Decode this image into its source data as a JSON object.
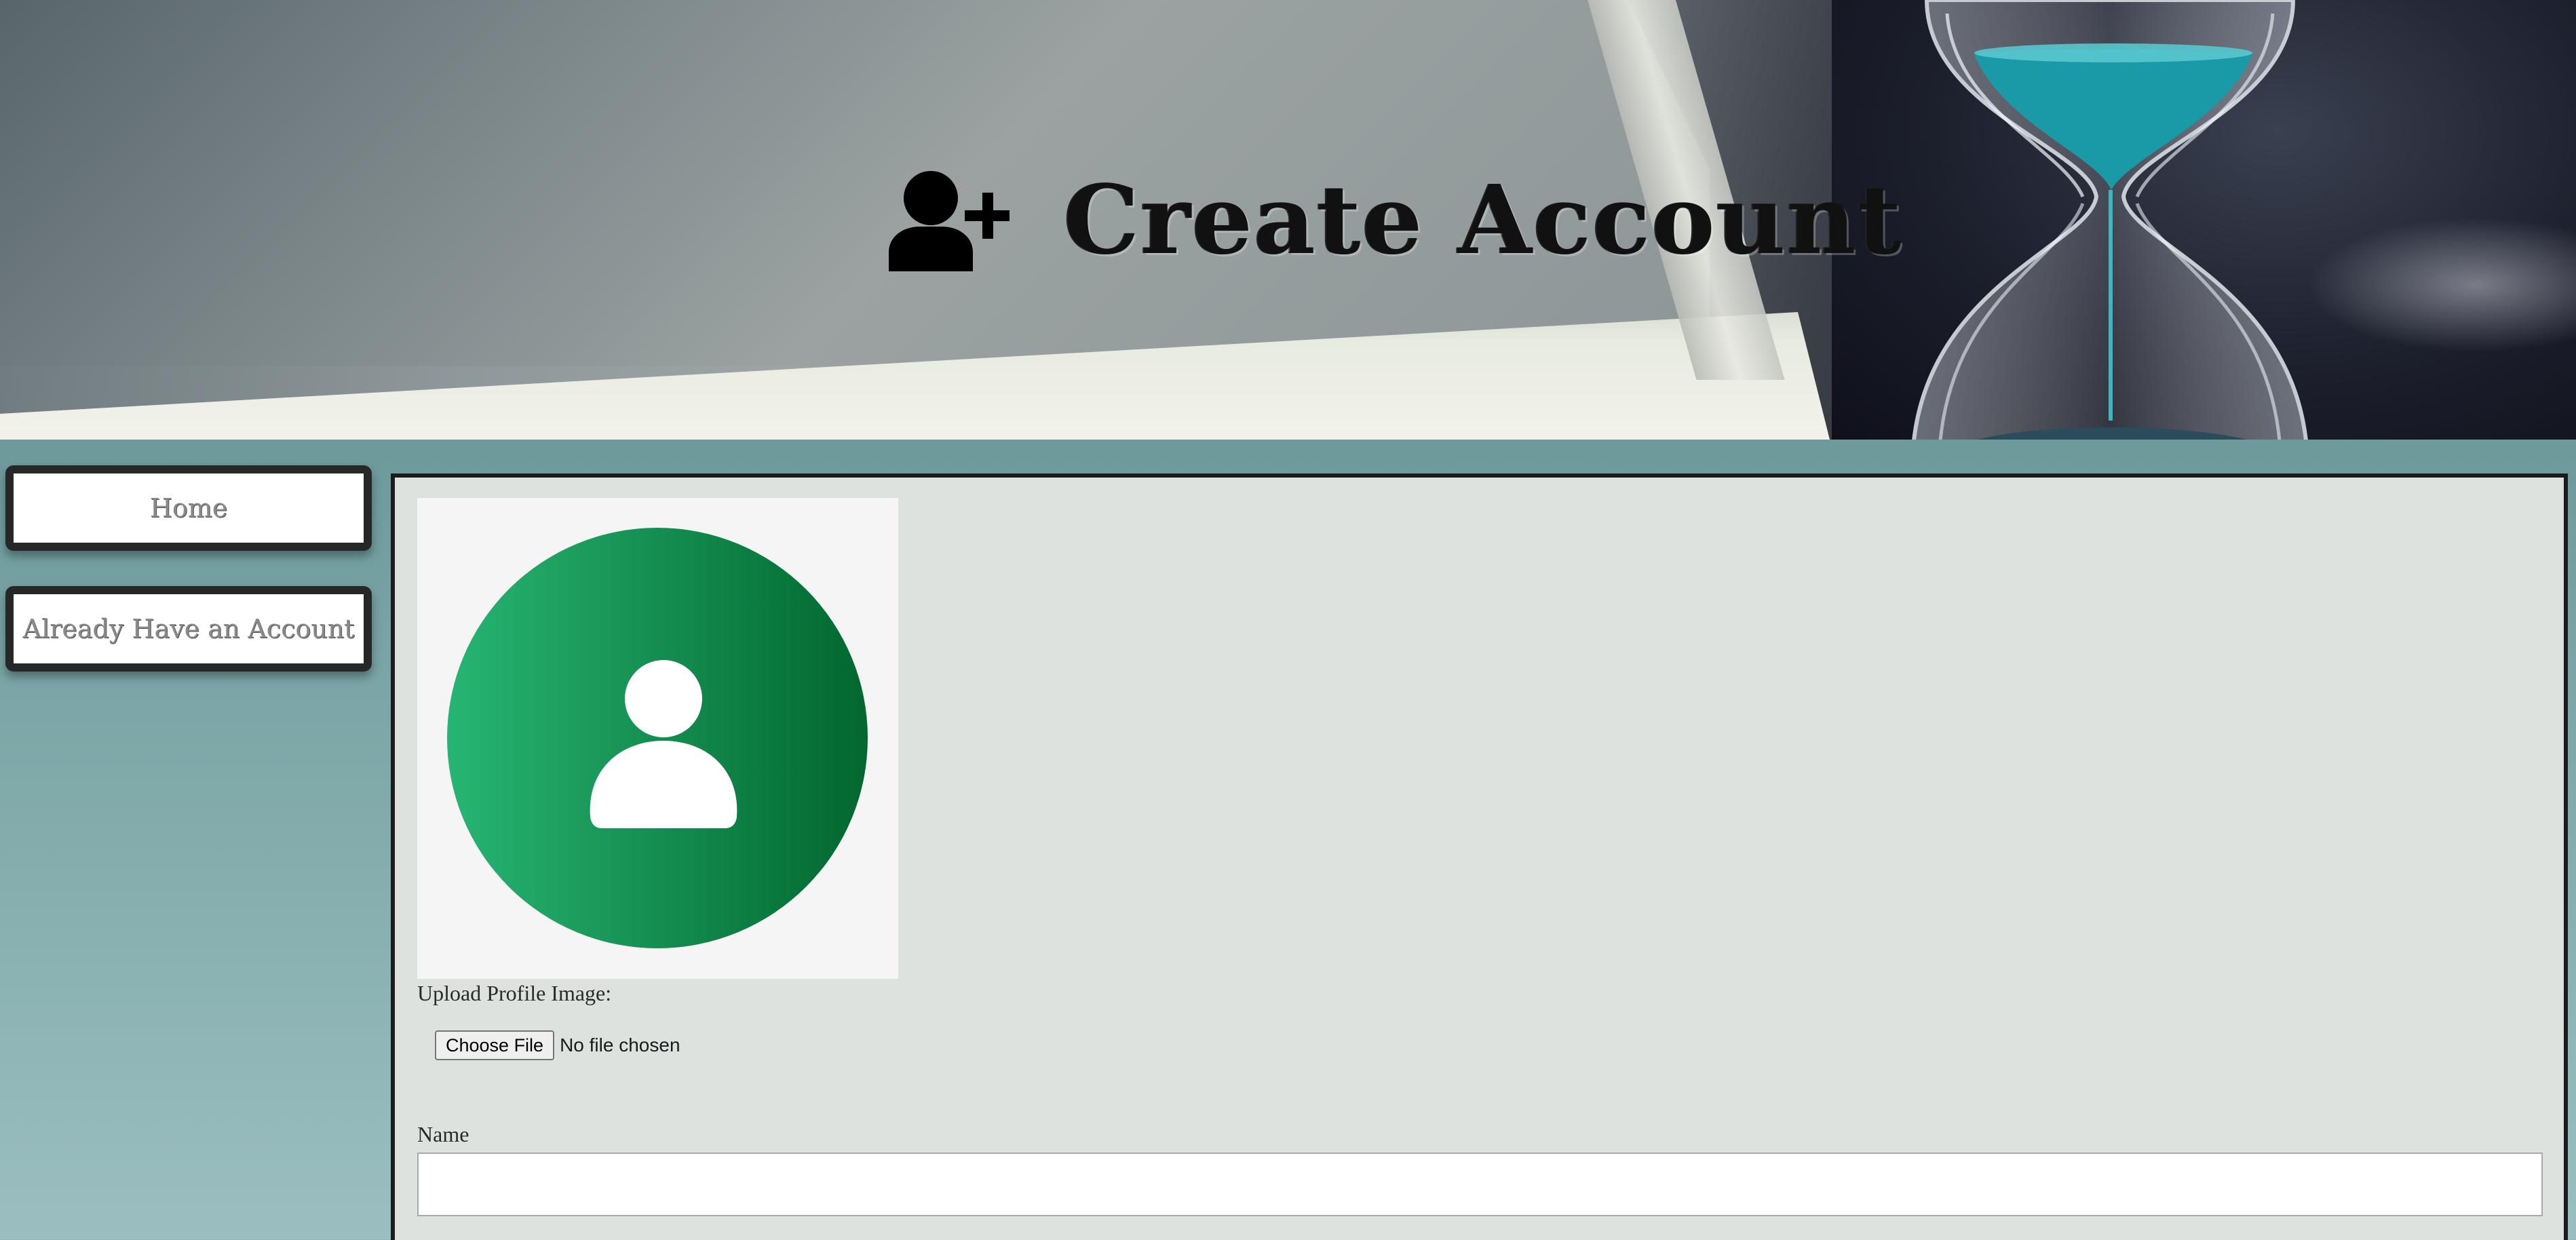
{
  "header": {
    "title": "Create Account",
    "icon": "user-plus-icon"
  },
  "sidebar": {
    "items": [
      {
        "label": "Home"
      },
      {
        "label": "Already Have an Account"
      }
    ]
  },
  "form": {
    "avatar_icon": "user-avatar-icon",
    "upload_label": "Upload Profile Image:",
    "file_button_label": "Choose File",
    "file_status": "No file chosen",
    "name_label": "Name",
    "name_value": ""
  },
  "colors": {
    "avatar_gradient_start": "#27b573",
    "avatar_gradient_end": "#02672e",
    "panel_background": "#dde2df",
    "sidebar_button_border": "#262828",
    "page_background": "#6f9b9c"
  }
}
